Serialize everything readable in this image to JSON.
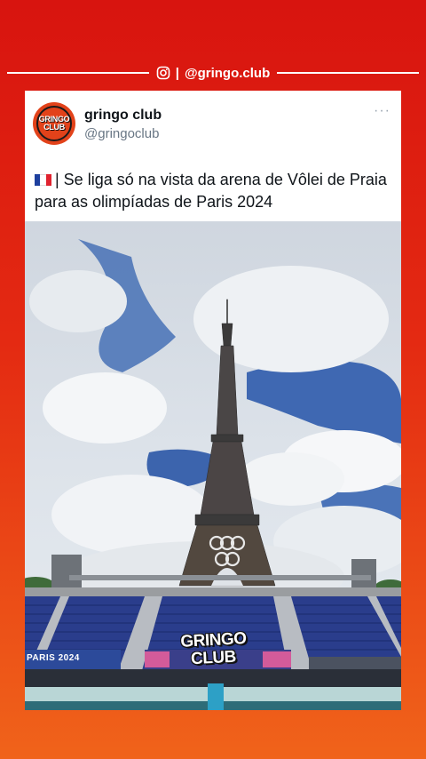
{
  "top_bar": {
    "separator": "|",
    "handle": "@gringo.club",
    "icon": "instagram-icon"
  },
  "post": {
    "avatar_text_line1": "GRINGO",
    "avatar_text_line2": "CLUB",
    "display_name": "gringo club",
    "username": "@gringoclub",
    "more_label": "···",
    "text": "| Se liga só na vista da arena de Vôlei de Praia para as olimpíadas de Paris 2024",
    "flag": "france-flag-icon"
  },
  "media": {
    "banner_text": "PARIS 2024",
    "watermark_line1": "GRINGO",
    "watermark_line2": "CLUB"
  },
  "colors": {
    "background_top": "#d8140f",
    "background_bottom": "#f0631a",
    "card": "#ffffff",
    "text_primary": "#0f1419",
    "text_secondary": "#687684"
  }
}
